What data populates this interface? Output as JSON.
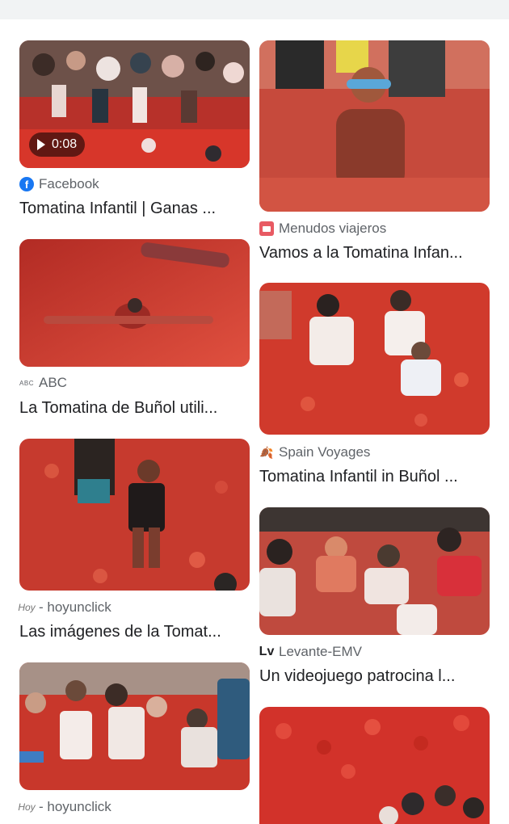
{
  "results": [
    {
      "source": "Facebook",
      "title": "Tomatina Infantil | Ganas ...",
      "video_duration": "0:08",
      "source_icon": "facebook-icon"
    },
    {
      "source": "Menudos viajeros",
      "title": "Vamos a la Tomatina Infan...",
      "source_icon": "menudos-viajeros-icon"
    },
    {
      "source": "ABC",
      "title": "La Tomatina de Buñol utili...",
      "source_icon": "abc-icon",
      "icon_text": "ABC"
    },
    {
      "source": "Spain Voyages",
      "title": "Tomatina Infantil in Buñol ...",
      "source_icon": "spain-voyages-icon"
    },
    {
      "source": "- hoyunclick",
      "title": "Las imágenes de la Tomat...",
      "source_icon": "hoyunclick-icon",
      "icon_text": "Hoy"
    },
    {
      "source": "Levante-EMV",
      "title": "Un videojuego patrocina l...",
      "source_icon": "levante-emv-icon",
      "icon_text": "Lv"
    },
    {
      "source": "- hoyunclick",
      "source_icon": "hoyunclick-icon",
      "icon_text": "Hoy"
    }
  ],
  "colors": {
    "tomato": "#c8281e",
    "text": "#202124",
    "secondary": "#5f6368",
    "facebook": "#1877f2"
  }
}
